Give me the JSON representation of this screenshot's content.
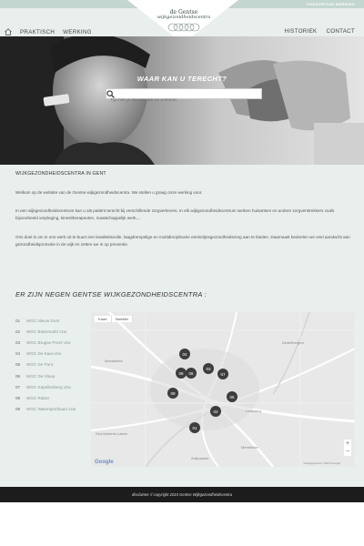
{
  "top_strip": {
    "lang_label": "CONSORTIUM WERKING"
  },
  "logo": {
    "line1": "de Gentse",
    "line2": "wijkgezondheidscentra"
  },
  "nav": {
    "left": [
      {
        "label": "PRAKTISCH"
      },
      {
        "label": "WERKING"
      }
    ],
    "right": [
      {
        "label": "HISTORIEK"
      },
      {
        "label": "CONTACT"
      }
    ]
  },
  "hero": {
    "title": "WAAR KAN U TERECHT?",
    "search_placeholder": "Typ hier je straatnaam en nummer"
  },
  "intro": {
    "title": "WIJKGEZONDHEIDSCENTRA IN GENT",
    "paragraph1": "Welkom op de website van de Gentse wijkgezondheidscentra. We stellen u graag onze werking voor.",
    "paragraph2": "In een wijkgezondheidscentrum kan u als patiënt terecht bij verschillende zorgverleners. In elk wijkgezondheidscentrum werken huisartsen en andere zorgverstrekkers zoals bijvoorbeeld verpleging, kinesitherapeuten, maatschappelijk werk,...",
    "paragraph3": "Ons doel is om in ons werk uit te buurt een kwaliteitsvolle, laagdrempelige en multidisciplinaire eerstelijnsgezondheidszorg aan te bieden. Daarnaast bedoelen we veel aandacht aan gezondheidspromotie in de wijk en zetten we in op preventie."
  },
  "section": {
    "title": "ER ZIJN NEGEN GENTSE WIJKGEZONDHEIDSCENTRA :"
  },
  "centra": [
    {
      "num": "01",
      "name": "WGC Nieuw Gent"
    },
    {
      "num": "02",
      "name": "WGC Botermarkt vzw"
    },
    {
      "num": "03",
      "name": "WGC Brugse Poort vzw"
    },
    {
      "num": "04",
      "name": "WGC De Kaai vzw"
    },
    {
      "num": "05",
      "name": "WGC De Punt"
    },
    {
      "num": "06",
      "name": "WGC De Sloep"
    },
    {
      "num": "07",
      "name": "WGC Kapellenberg vzw"
    },
    {
      "num": "08",
      "name": "WGC Rabot"
    },
    {
      "num": "09",
      "name": "WGC Watersportbaan vzw"
    }
  ],
  "map": {
    "controls": [
      "Kaart",
      "Satelliet"
    ],
    "zoom_in": "+",
    "zoom_out": "−",
    "google": "Google",
    "credit": "Kaartgegevens ©2015 Google",
    "places": [
      "Mariakerke",
      "Destelbergen",
      "Merelbeke",
      "Ledeberg",
      "Sint-Martens-Latem",
      "Zwijnaarde"
    ],
    "markers": [
      {
        "label": "04"
      },
      {
        "label": "08"
      },
      {
        "label": "06"
      },
      {
        "label": "03"
      },
      {
        "label": "07"
      },
      {
        "label": "09"
      },
      {
        "label": "05"
      },
      {
        "label": "02"
      },
      {
        "label": "01"
      }
    ]
  },
  "footer": {
    "text": "disclaimer // copyright 2015 Gentse Wijkgezondheidscentra"
  },
  "colors": {
    "header_bg": "#e9efec",
    "strip": "#c3d6cf",
    "footer_bg": "#1c1c1c",
    "marker": "#3d3d3d"
  }
}
